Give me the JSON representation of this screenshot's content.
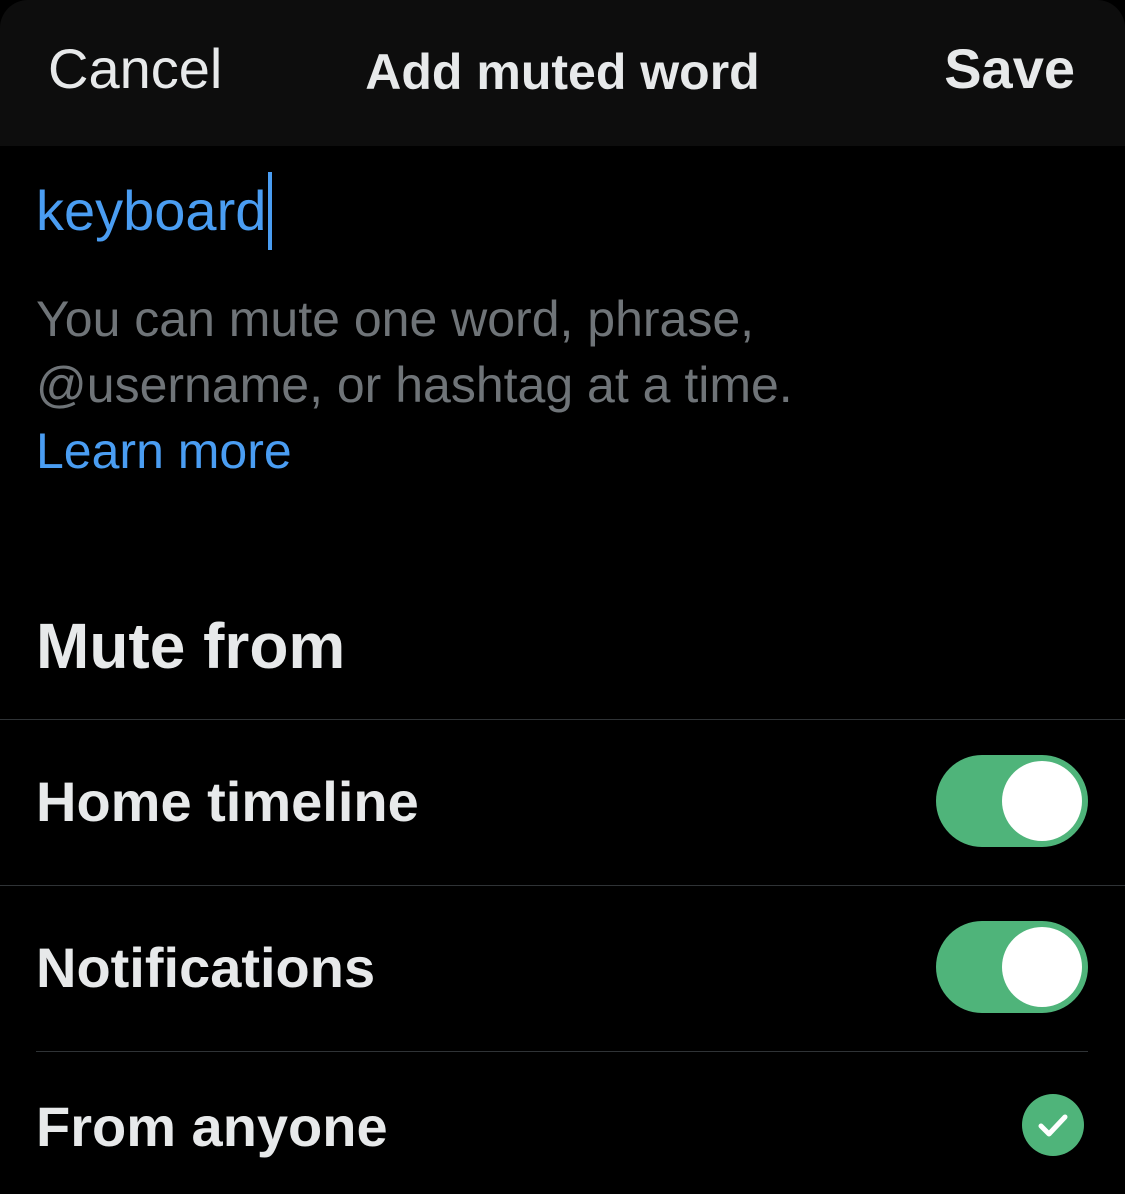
{
  "nav": {
    "cancel_label": "Cancel",
    "title": "Add muted word",
    "save_label": "Save"
  },
  "word_input": {
    "value": "keyboard"
  },
  "helper": {
    "line1": "You can mute one word, phrase,",
    "line2": "@username, or hashtag at a time.",
    "learn_more": "Learn more"
  },
  "mute_from": {
    "title": "Mute from",
    "options": [
      {
        "label": "Home timeline",
        "control": "toggle",
        "enabled": true
      },
      {
        "label": "Notifications",
        "control": "toggle",
        "enabled": true
      },
      {
        "label": "From anyone",
        "control": "checkmark",
        "selected": true
      }
    ]
  },
  "colors": {
    "accent_blue": "#4a9df2",
    "toggle_green": "#4fb47a",
    "helper_gray": "#6f7478",
    "background": "#000000"
  },
  "icons": {
    "selected_icon": "checkmark-circle-icon"
  }
}
